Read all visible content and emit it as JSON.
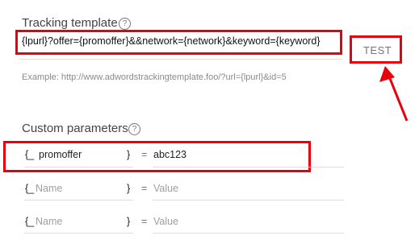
{
  "tracking": {
    "title": "Tracking template",
    "help_glyph": "?",
    "value": "{lpurl}?offer={promoffer}&&network={network}&keyword={keyword}",
    "test_label": "TEST",
    "example": "Example: http://www.adwordstrackingtemplate.foo/?url={lpurl}&id=5"
  },
  "custom": {
    "title": "Custom parameters",
    "help_glyph": "?",
    "rows": [
      {
        "prefix": "{_",
        "name": "promoffer",
        "close": "}",
        "eq": "=",
        "value": "abc123",
        "filled": true
      },
      {
        "prefix": "{_",
        "name": "Name",
        "close": "}",
        "eq": "=",
        "value": "Value",
        "filled": false
      },
      {
        "prefix": "{_",
        "name": "Name",
        "close": "}",
        "eq": "=",
        "value": "Value",
        "filled": false
      }
    ]
  },
  "annotation": {
    "color": "#e8000d"
  }
}
